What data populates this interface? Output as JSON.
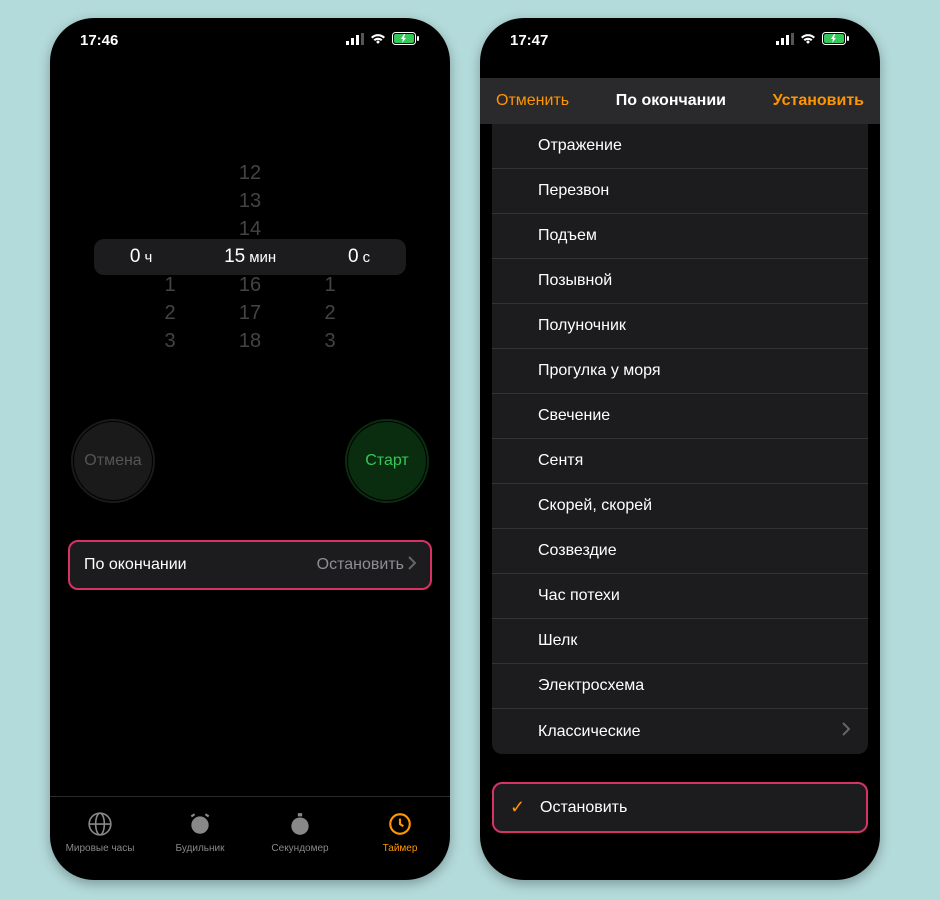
{
  "statusBar": {
    "time1": "17:46",
    "time2": "17:47"
  },
  "timer": {
    "picker": {
      "h_val": "0",
      "h_unit": "ч",
      "m_val": "15",
      "m_unit": "мин",
      "s_val": "0",
      "s_unit": "с",
      "h_ghost": [
        "",
        "",
        "",
        "1",
        "2",
        "3"
      ],
      "m_ghost": [
        "12",
        "13",
        "14",
        "16",
        "17",
        "18"
      ],
      "s_ghost": [
        "",
        "",
        "",
        "1",
        "2",
        "3"
      ]
    },
    "cancel": "Отмена",
    "start": "Старт",
    "end_label": "По окончании",
    "end_value": "Остановить"
  },
  "tabs": {
    "world": "Мировые часы",
    "alarm": "Будильник",
    "stopwatch": "Секундомер",
    "timer": "Таймер"
  },
  "modal": {
    "cancel": "Отменить",
    "title": "По окончании",
    "set": "Установить",
    "sounds": [
      "Отражение",
      "Перезвон",
      "Подъем",
      "Позывной",
      "Полуночник",
      "Прогулка у моря",
      "Свечение",
      "Сентя",
      "Скорей, скорей",
      "Созвездие",
      "Час потехи",
      "Шелк",
      "Электросхема"
    ],
    "classic": "Классические",
    "stop": "Остановить"
  },
  "colors": {
    "accent": "#ff9500",
    "highlight": "#d63364",
    "green": "#34c759"
  }
}
